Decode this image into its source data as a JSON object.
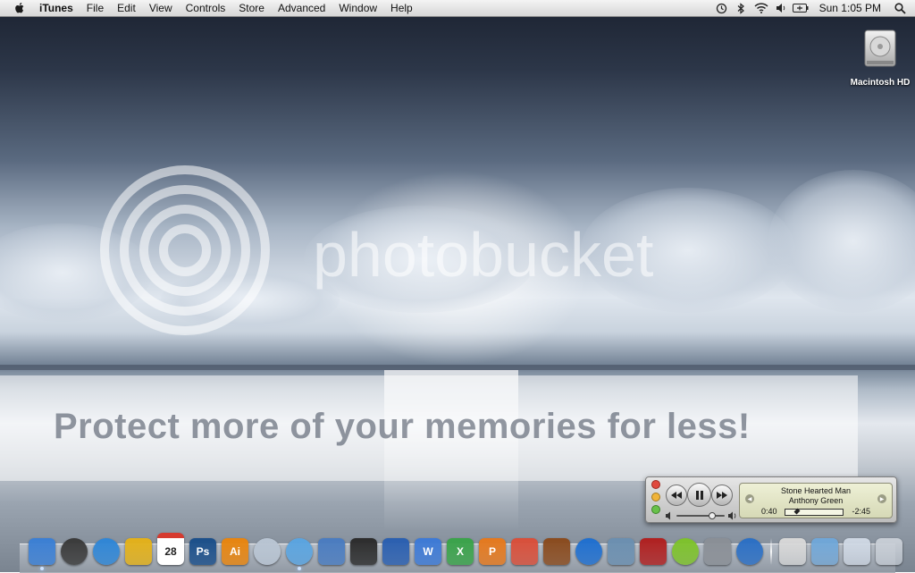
{
  "menubar": {
    "app_name": "iTunes",
    "menus": [
      "File",
      "Edit",
      "View",
      "Controls",
      "Store",
      "Advanced",
      "Window",
      "Help"
    ],
    "status_icons": [
      "time-machine-icon",
      "bluetooth-icon",
      "wifi-icon",
      "volume-icon",
      "battery-icon"
    ],
    "clock": "Sun 1:05 PM"
  },
  "desktop": {
    "drive_label": "Macintosh HD"
  },
  "watermark": {
    "tagline": "Protect more of your memories for less!",
    "brand": "photobucket"
  },
  "mini_player": {
    "song_title": "Stone Hearted Man",
    "artist": "Anthony Green",
    "elapsed": "0:40",
    "remaining": "-2:45",
    "progress": 0.2
  },
  "dock": {
    "apps": [
      {
        "name": "finder-icon",
        "label": "",
        "color": "#3b7fd4"
      },
      {
        "name": "dashboard-icon",
        "label": "",
        "color": "#3a3a3a"
      },
      {
        "name": "safari-icon",
        "label": "",
        "color": "#2f86d6"
      },
      {
        "name": "adium-icon",
        "label": "",
        "color": "#e3b11a"
      },
      {
        "name": "ical-icon",
        "label": "28",
        "color": "#ffffff"
      },
      {
        "name": "photoshop-icon",
        "label": "Ps",
        "color": "#1b4f8a"
      },
      {
        "name": "illustrator-icon",
        "label": "Ai",
        "color": "#e8850f"
      },
      {
        "name": "dvd-icon",
        "label": "",
        "color": "#b9c5d3"
      },
      {
        "name": "itunes-icon",
        "label": "",
        "color": "#5aa4e0"
      },
      {
        "name": "mail-icon",
        "label": "",
        "color": "#4a7cc0"
      },
      {
        "name": "imovie-icon",
        "label": "",
        "color": "#2c2c2c"
      },
      {
        "name": "final-cut-icon",
        "label": "",
        "color": "#2a5fb0"
      },
      {
        "name": "word-icon",
        "label": "W",
        "color": "#3d7ad6"
      },
      {
        "name": "excel-icon",
        "label": "X",
        "color": "#3aa34a"
      },
      {
        "name": "powerpoint-icon",
        "label": "P",
        "color": "#e5791e"
      },
      {
        "name": "cocktail-icon",
        "label": "",
        "color": "#d94f3a"
      },
      {
        "name": "garageband-icon",
        "label": "",
        "color": "#8a4b1e"
      },
      {
        "name": "quicktime-icon",
        "label": "",
        "color": "#1f6fcf"
      },
      {
        "name": "iphoto-icon",
        "label": "",
        "color": "#6b8fb0"
      },
      {
        "name": "photo-booth-icon",
        "label": "",
        "color": "#b02020"
      },
      {
        "name": "limewire-icon",
        "label": "",
        "color": "#7ec22b"
      },
      {
        "name": "system-preferences-icon",
        "label": "",
        "color": "#8a8f96"
      },
      {
        "name": "dvd-player-icon",
        "label": "",
        "color": "#2b6fc4"
      }
    ],
    "stacks": [
      {
        "name": "documents-stack-icon",
        "color": "#d8d8d8"
      },
      {
        "name": "applications-folder-icon",
        "color": "#6fa7d9"
      },
      {
        "name": "downloads-stack-icon",
        "color": "#cfd8e4"
      },
      {
        "name": "trash-icon",
        "color": "#c8ced6"
      }
    ]
  }
}
